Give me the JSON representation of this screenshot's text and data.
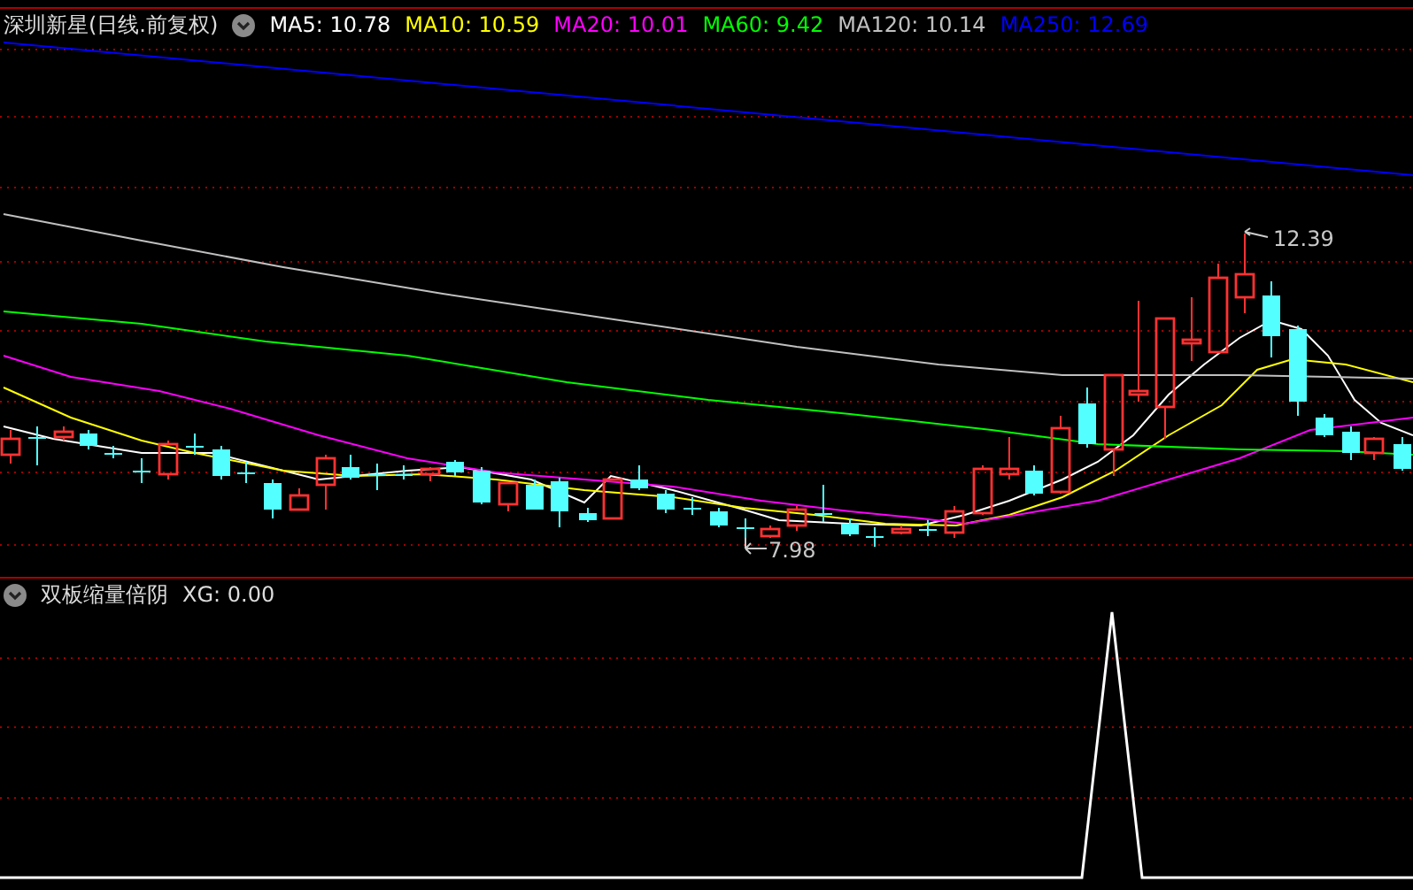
{
  "main_chart": {
    "title": "深圳新星(日线.前复权)",
    "indicators": [
      {
        "label": "MA5: 10.78",
        "color": "#ffffff"
      },
      {
        "label": "MA10: 10.59",
        "color": "#ffff00"
      },
      {
        "label": "MA20: 10.01",
        "color": "#ff00ff"
      },
      {
        "label": "MA60: 9.42",
        "color": "#00ff00"
      },
      {
        "label": "MA120: 10.14",
        "color": "#c0c0c0"
      },
      {
        "label": "MA250: 12.69",
        "color": "#0000ff"
      }
    ],
    "high_marker": "12.39",
    "low_marker": "7.98"
  },
  "sub_chart": {
    "title": "双板缩量倍阴",
    "indicator": "XG: 0.00"
  }
}
